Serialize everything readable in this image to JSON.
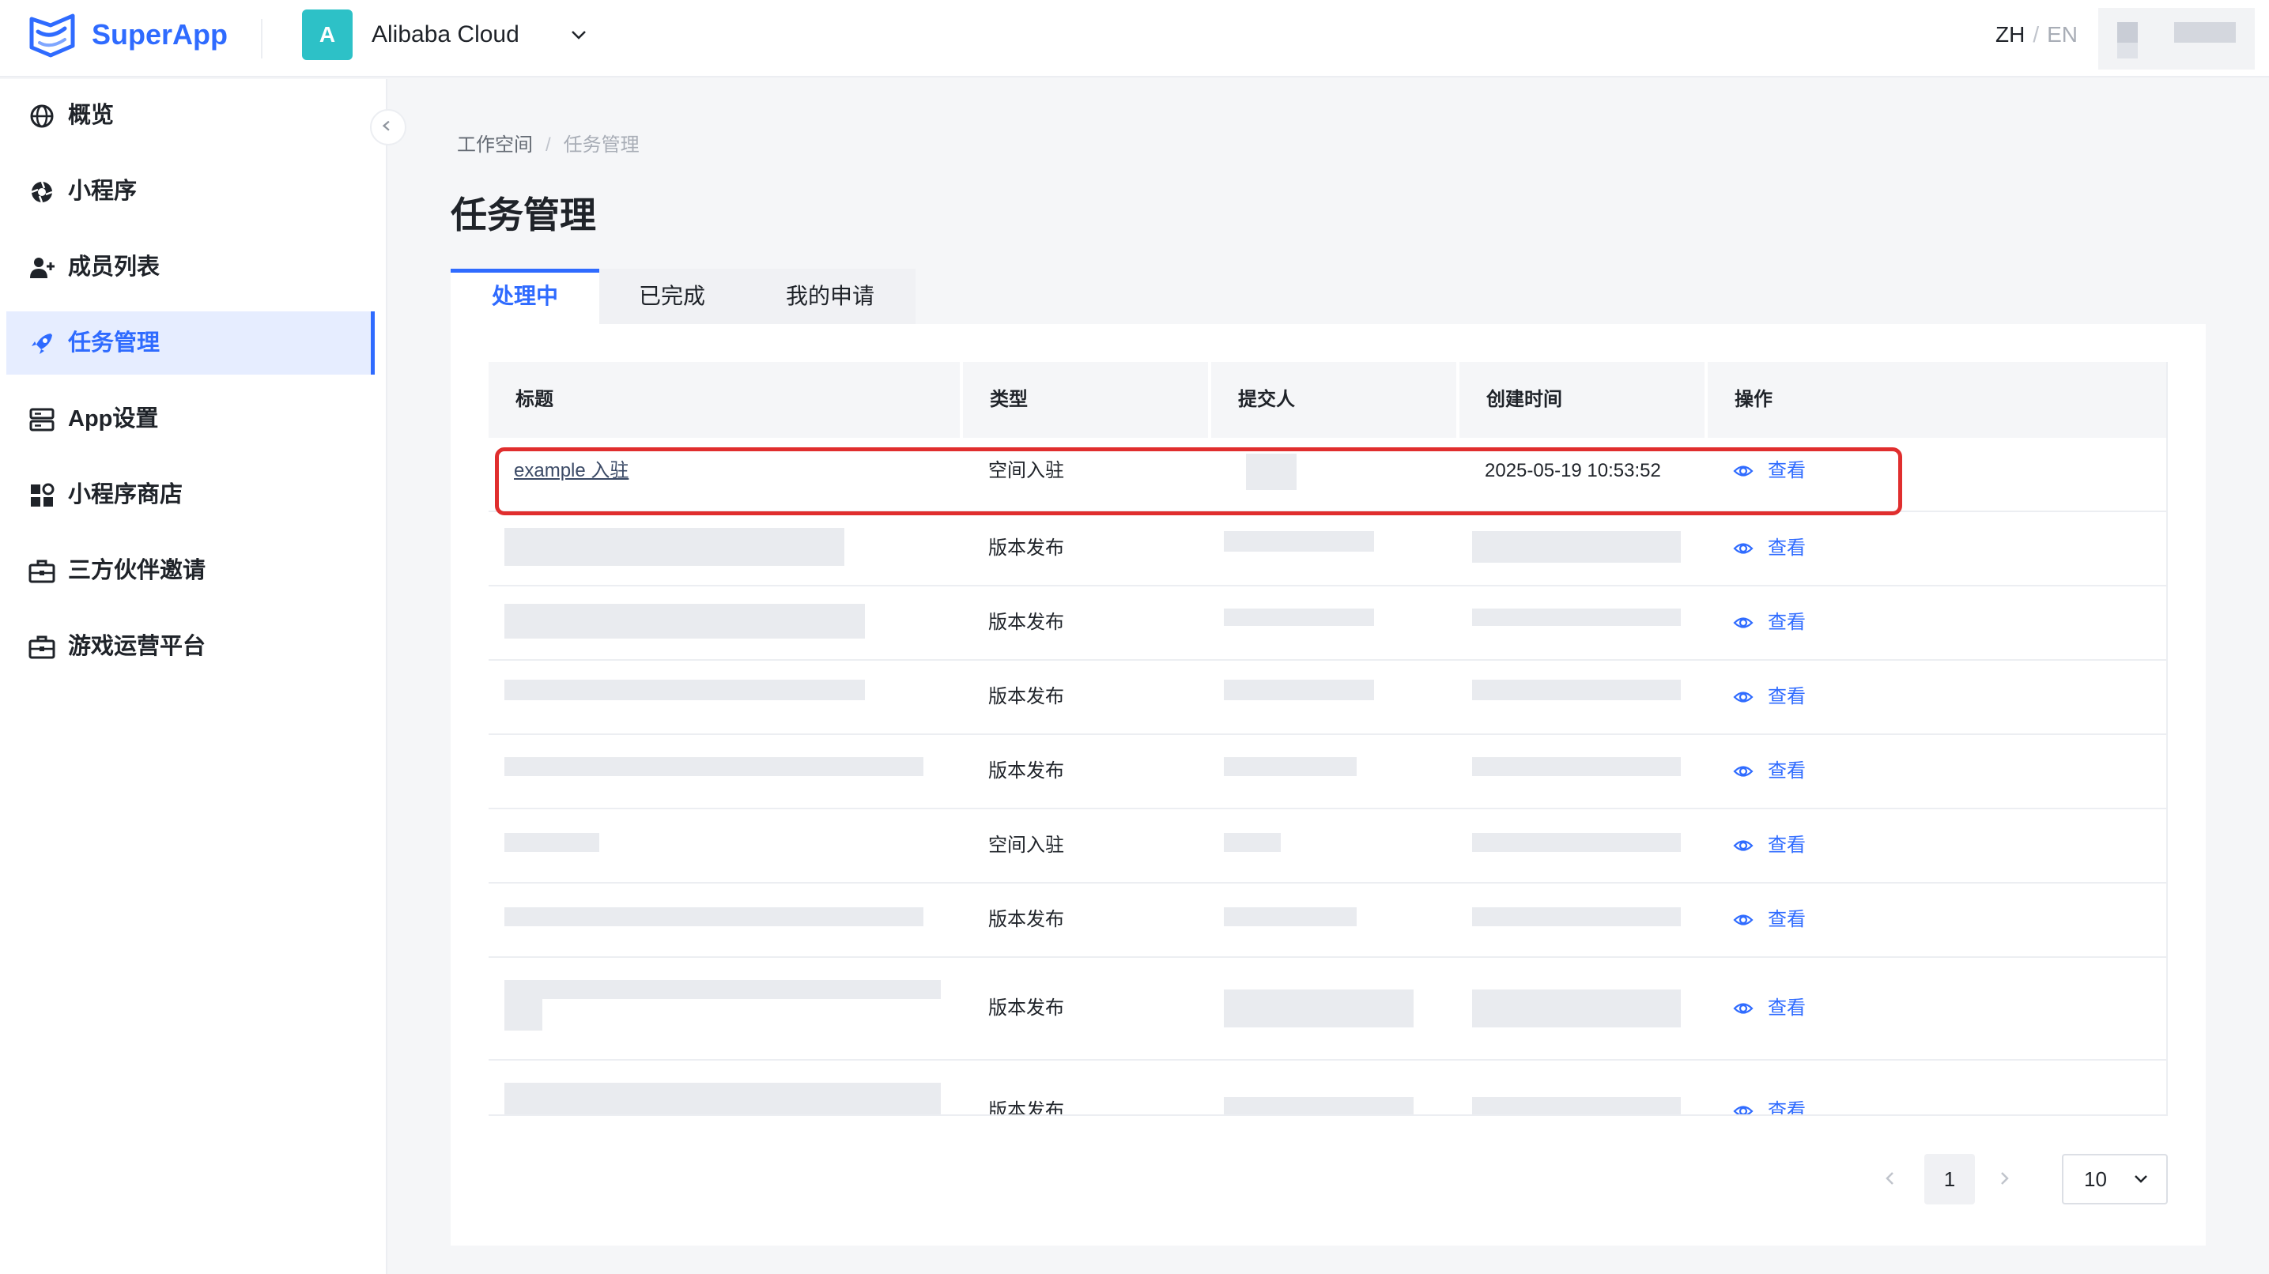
{
  "header": {
    "brand": "SuperApp",
    "workspace_avatar": "A",
    "workspace_name": "Alibaba Cloud",
    "lang_zh": "ZH",
    "lang_sep": "/",
    "lang_en": "EN"
  },
  "sidebar": {
    "items": [
      {
        "label": "概览",
        "icon": "globe-icon"
      },
      {
        "label": "小程序",
        "icon": "aperture-icon"
      },
      {
        "label": "成员列表",
        "icon": "add-user-icon"
      },
      {
        "label": "任务管理",
        "icon": "rocket-icon",
        "active": true
      },
      {
        "label": "App设置",
        "icon": "server-icon"
      },
      {
        "label": "小程序商店",
        "icon": "grid-icon"
      },
      {
        "label": "三方伙伴邀请",
        "icon": "briefcase-icon"
      },
      {
        "label": "游戏运营平台",
        "icon": "briefcase-icon"
      }
    ]
  },
  "breadcrumb": {
    "root": "工作空间",
    "sep": "/",
    "current": "任务管理"
  },
  "page_title": "任务管理",
  "tabs": [
    {
      "label": "处理中",
      "active": true
    },
    {
      "label": "已完成"
    },
    {
      "label": "我的申请"
    }
  ],
  "table": {
    "headers": [
      "标题",
      "类型",
      "提交人",
      "创建时间",
      "操作"
    ],
    "rows": [
      {
        "title": "example 入驻",
        "type": "空间入驻",
        "created": "2025-05-19 10:53:52",
        "action": "查看"
      },
      {
        "title": "",
        "type": "版本发布",
        "created": "",
        "action": "查看"
      },
      {
        "title": "",
        "type": "版本发布",
        "created": "",
        "action": "查看"
      },
      {
        "title": "",
        "type": "版本发布",
        "created": "",
        "action": "查看"
      },
      {
        "title": "",
        "type": "版本发布",
        "created": "",
        "action": "查看"
      },
      {
        "title": "",
        "type": "空间入驻",
        "created": "",
        "action": "查看"
      },
      {
        "title": "",
        "type": "版本发布",
        "created": "",
        "action": "查看"
      },
      {
        "title": "",
        "type": "版本发布",
        "created": "",
        "action": "查看"
      },
      {
        "title": "",
        "type": "版本发布",
        "created": "",
        "action": "查看"
      }
    ]
  },
  "pagination": {
    "current_page": "1",
    "page_size": "10"
  },
  "colors": {
    "primary": "#2f6bff",
    "highlight": "#e02e2e",
    "teal": "#2dc1c7"
  }
}
